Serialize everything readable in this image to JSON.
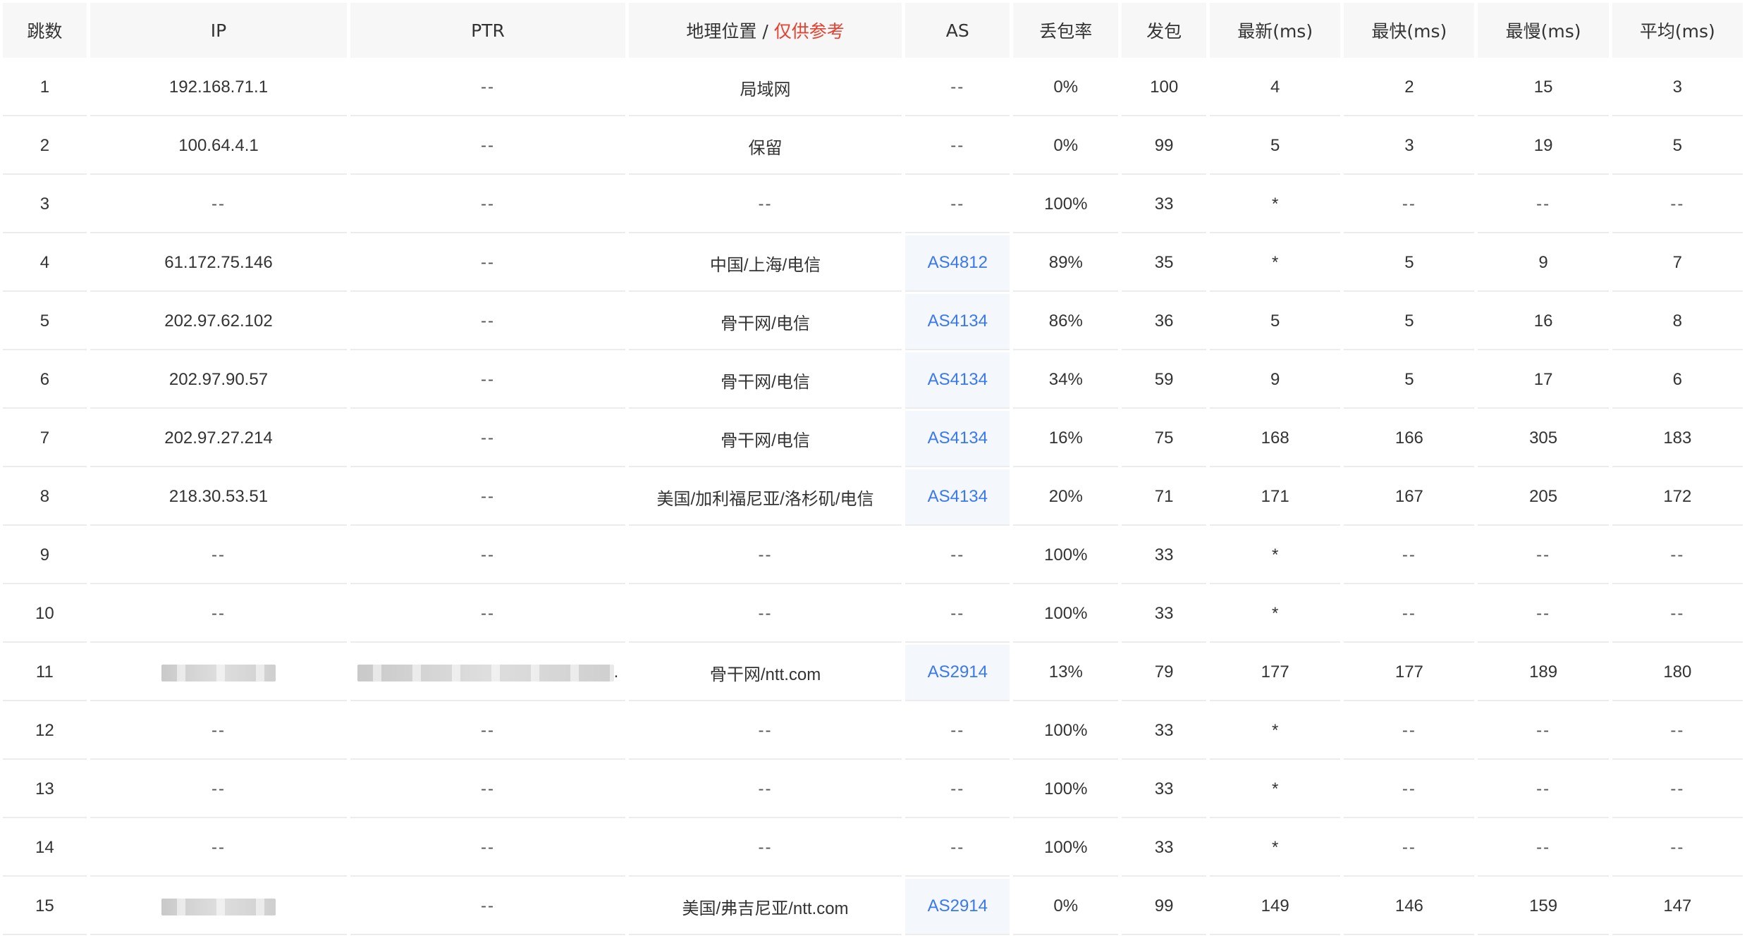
{
  "table": {
    "headers": {
      "hop": "跳数",
      "ip": "IP",
      "ptr": "PTR",
      "geo": "地理位置",
      "geo_sep": "/",
      "geo_note": "仅供参考",
      "as": "AS",
      "loss": "丢包率",
      "sent": "发包",
      "last": "最新(ms)",
      "best": "最快(ms)",
      "worst": "最慢(ms)",
      "avg": "平均(ms)"
    },
    "rows": [
      {
        "hop": "1",
        "ip": "192.168.71.1",
        "ptr": "--",
        "geo": "局域网",
        "as": "--",
        "loss": "0%",
        "sent": "100",
        "last": "4",
        "best": "2",
        "worst": "15",
        "avg": "3"
      },
      {
        "hop": "2",
        "ip": "100.64.4.1",
        "ptr": "--",
        "geo": "保留",
        "as": "--",
        "loss": "0%",
        "sent": "99",
        "last": "5",
        "best": "3",
        "worst": "19",
        "avg": "5"
      },
      {
        "hop": "3",
        "ip": "--",
        "ptr": "--",
        "geo": "--",
        "as": "--",
        "loss": "100%",
        "sent": "33",
        "last": "*",
        "best": "--",
        "worst": "--",
        "avg": "--"
      },
      {
        "hop": "4",
        "ip": "61.172.75.146",
        "ptr": "--",
        "geo": "中国/上海/电信",
        "as": "AS4812",
        "loss": "89%",
        "sent": "35",
        "last": "*",
        "best": "5",
        "worst": "9",
        "avg": "7"
      },
      {
        "hop": "5",
        "ip": "202.97.62.102",
        "ptr": "--",
        "geo": "骨干网/电信",
        "as": "AS4134",
        "loss": "86%",
        "sent": "36",
        "last": "5",
        "best": "5",
        "worst": "16",
        "avg": "8"
      },
      {
        "hop": "6",
        "ip": "202.97.90.57",
        "ptr": "--",
        "geo": "骨干网/电信",
        "as": "AS4134",
        "loss": "34%",
        "sent": "59",
        "last": "9",
        "best": "5",
        "worst": "17",
        "avg": "6"
      },
      {
        "hop": "7",
        "ip": "202.97.27.214",
        "ptr": "--",
        "geo": "骨干网/电信",
        "as": "AS4134",
        "loss": "16%",
        "sent": "75",
        "last": "168",
        "best": "166",
        "worst": "305",
        "avg": "183"
      },
      {
        "hop": "8",
        "ip": "218.30.53.51",
        "ptr": "--",
        "geo": "美国/加利福尼亚/洛杉矶/电信",
        "as": "AS4134",
        "loss": "20%",
        "sent": "71",
        "last": "171",
        "best": "167",
        "worst": "205",
        "avg": "172"
      },
      {
        "hop": "9",
        "ip": "--",
        "ptr": "--",
        "geo": "--",
        "as": "--",
        "loss": "100%",
        "sent": "33",
        "last": "*",
        "best": "--",
        "worst": "--",
        "avg": "--"
      },
      {
        "hop": "10",
        "ip": "--",
        "ptr": "--",
        "geo": "--",
        "as": "--",
        "loss": "100%",
        "sent": "33",
        "last": "*",
        "best": "--",
        "worst": "--",
        "avg": "--"
      },
      {
        "hop": "11",
        "ip": "",
        "ptr": ".",
        "geo": "骨干网/ntt.com",
        "as": "AS2914",
        "loss": "13%",
        "sent": "79",
        "last": "177",
        "best": "177",
        "worst": "189",
        "avg": "180"
      },
      {
        "hop": "12",
        "ip": "--",
        "ptr": "--",
        "geo": "--",
        "as": "--",
        "loss": "100%",
        "sent": "33",
        "last": "*",
        "best": "--",
        "worst": "--",
        "avg": "--"
      },
      {
        "hop": "13",
        "ip": "--",
        "ptr": "--",
        "geo": "--",
        "as": "--",
        "loss": "100%",
        "sent": "33",
        "last": "*",
        "best": "--",
        "worst": "--",
        "avg": "--"
      },
      {
        "hop": "14",
        "ip": "--",
        "ptr": "--",
        "geo": "--",
        "as": "--",
        "loss": "100%",
        "sent": "33",
        "last": "*",
        "best": "--",
        "worst": "--",
        "avg": "--"
      },
      {
        "hop": "15",
        "ip": "",
        "ptr": "--",
        "geo": "美国/弗吉尼亚/ntt.com",
        "as": "AS2914",
        "loss": "0%",
        "sent": "99",
        "last": "149",
        "best": "146",
        "worst": "159",
        "avg": "147"
      }
    ]
  },
  "colors": {
    "header_bg": "#f7f7f8",
    "note_red": "#e8402f",
    "link_blue": "#3a78f2",
    "as_cell_bg": "#f4f7fb",
    "row_border": "#ececec"
  }
}
